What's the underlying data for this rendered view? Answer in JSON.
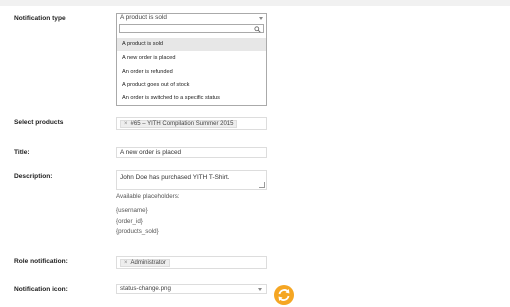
{
  "fields": {
    "notification_type": {
      "label": "Notification type",
      "selected": "A product is sold",
      "search_value": "",
      "options": [
        "A product is sold",
        "A new order is placed",
        "An order is refunded",
        "A product goes out of stock",
        "An order is switched to a specific status"
      ],
      "highlighted_option": "A product is sold"
    },
    "select_products": {
      "label": "Select products",
      "tag_remove": "×",
      "tag": "#65 – YITH Compilation Summer 2015"
    },
    "title": {
      "label": "Title:",
      "value": "A new order is placed"
    },
    "description": {
      "label": "Description:",
      "value": "John Doe has purchased YITH T-Shirt.",
      "hint_title": "Available placeholders:",
      "placeholders": [
        "{username}",
        "{order_id}",
        "{products_sold}"
      ]
    },
    "role_notification": {
      "label": "Role notification:",
      "tag_remove": "×",
      "tag": "Administrator"
    },
    "notification_icon": {
      "label": "Notification icon:",
      "selected": "status-change.png",
      "icon": "status-change-icon",
      "icon_color": "#f5a623"
    }
  }
}
